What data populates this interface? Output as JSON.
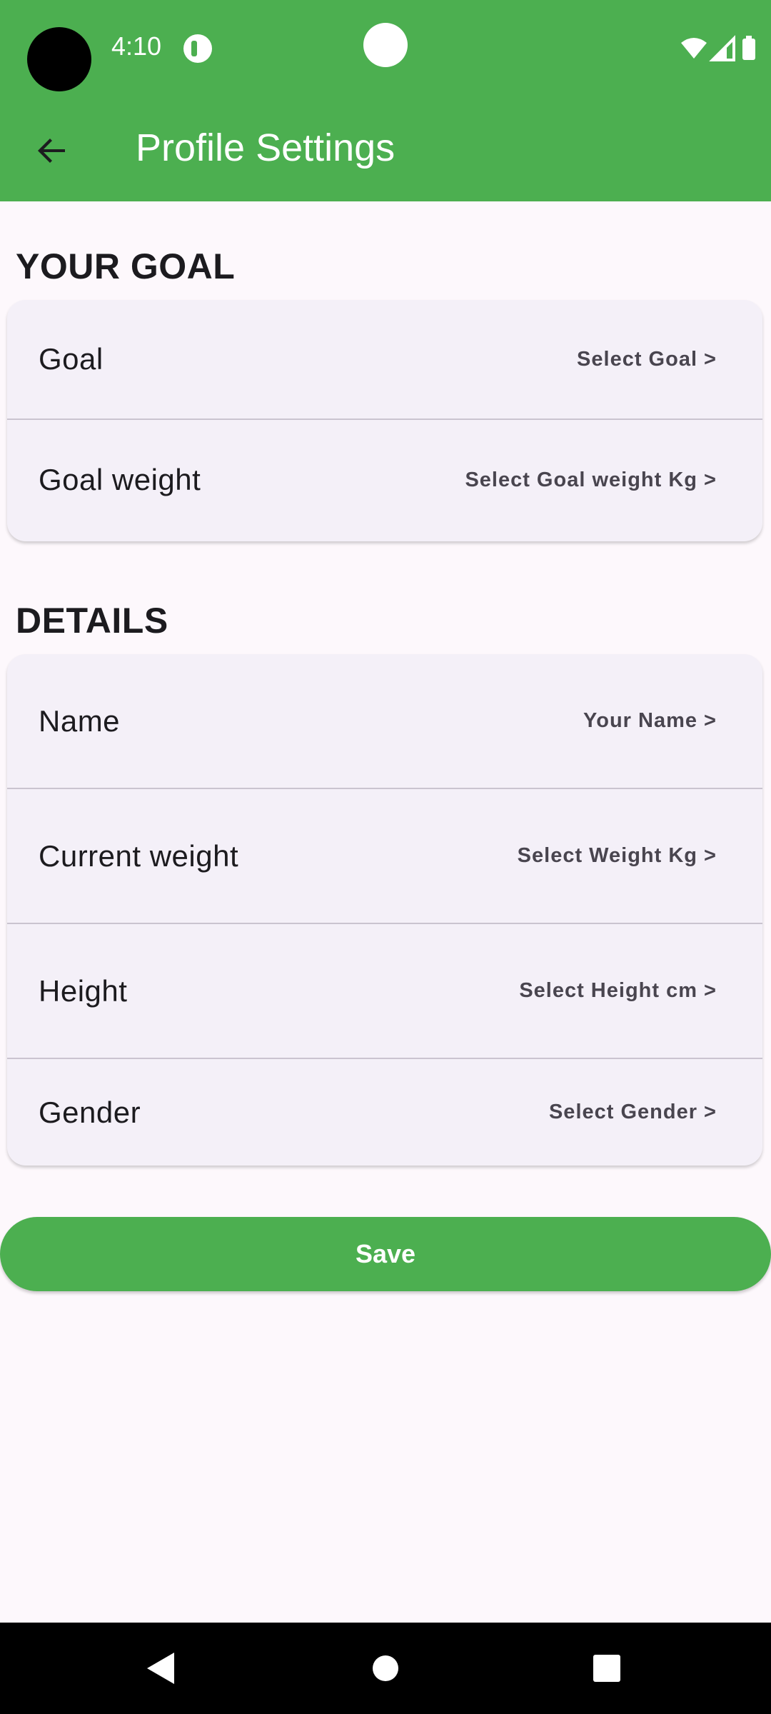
{
  "status_bar": {
    "time": "4:10",
    "icons": [
      "notification-app-icon",
      "wifi-icon",
      "cellular-icon",
      "battery-icon"
    ]
  },
  "app_bar": {
    "title": "Profile Settings",
    "back_icon": "arrow-back-icon",
    "color": "#4caf50"
  },
  "sections": {
    "goal": {
      "title": "YOUR GOAL",
      "rows": [
        {
          "label": "Goal",
          "value": "Select Goal >"
        },
        {
          "label": "Goal weight",
          "value": "Select Goal weight Kg >"
        }
      ]
    },
    "details": {
      "title": "DETAILS",
      "rows": [
        {
          "label": "Name",
          "value": "Your Name >"
        },
        {
          "label": "Current weight",
          "value": "Select Weight Kg >"
        },
        {
          "label": "Height",
          "value": "Select Height cm >"
        },
        {
          "label": "Gender",
          "value": "Select Gender >"
        }
      ]
    }
  },
  "save_button": {
    "label": "Save",
    "color": "#4caf50"
  },
  "nav_bar": {
    "icons": [
      "back-triangle-icon",
      "home-circle-icon",
      "recents-square-icon"
    ]
  }
}
